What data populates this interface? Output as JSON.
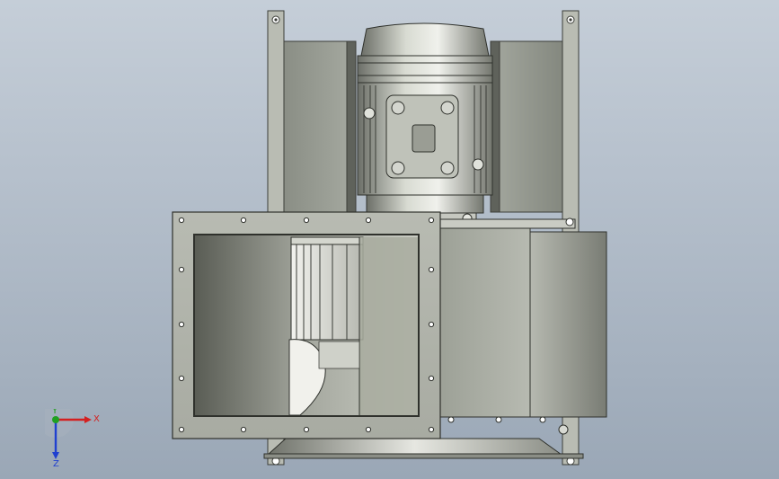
{
  "viewport": {
    "background_top": "#c5ced8",
    "background_bottom": "#9aa7b6"
  },
  "model": {
    "name": "",
    "parts": [
      "frame",
      "motor",
      "side-panel-left",
      "side-panel-right",
      "fan-housing",
      "inlet-flange",
      "impeller",
      "base-plate"
    ]
  },
  "triad": {
    "x_label": "X",
    "y_label": "Y",
    "z_label": "Z",
    "x_color": "#d42020",
    "y_color": "#20a020",
    "z_color": "#2040d0"
  }
}
